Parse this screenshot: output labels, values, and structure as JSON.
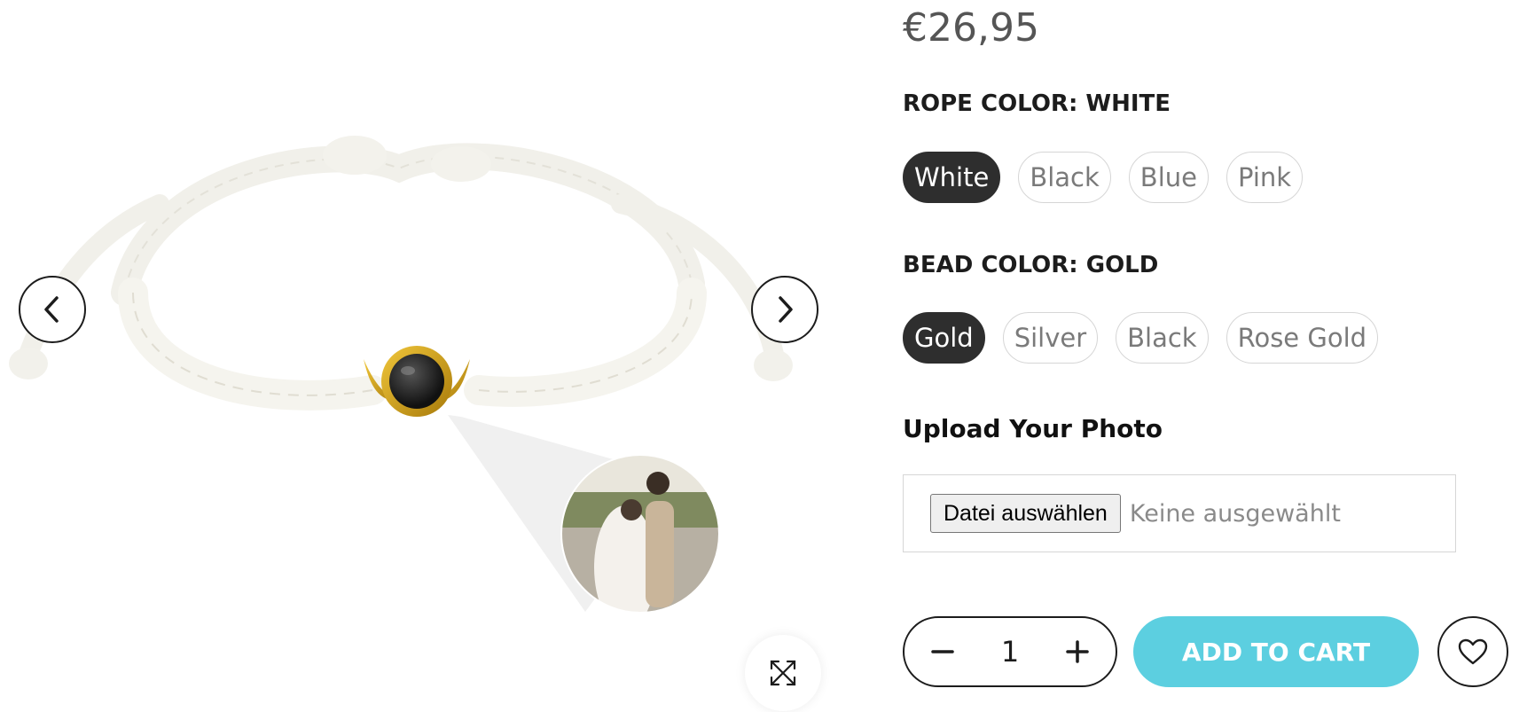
{
  "product": {
    "price": "€26,95"
  },
  "options": {
    "rope": {
      "label": "ROPE COLOR: ",
      "selected": "White",
      "values": [
        "White",
        "Black",
        "Blue",
        "Pink"
      ]
    },
    "bead": {
      "label": "BEAD COLOR: ",
      "selected": "Gold",
      "values": [
        "Gold",
        "Silver",
        "Black",
        "Rose Gold"
      ]
    }
  },
  "upload": {
    "title": "Upload Your Photo",
    "button_label": "Datei auswählen",
    "status": "Keine ausgewählt"
  },
  "cart": {
    "quantity": "1",
    "add_label": "ADD TO CART"
  },
  "colors": {
    "accent": "#5ccfe0",
    "selected_swatch": "#2e2e2e",
    "text": "#1c1c1c"
  },
  "icons": {
    "prev": "chevron-left-icon",
    "next": "chevron-right-icon",
    "expand": "expand-icon",
    "minus": "minus-icon",
    "plus": "plus-icon",
    "wishlist": "heart-icon"
  }
}
